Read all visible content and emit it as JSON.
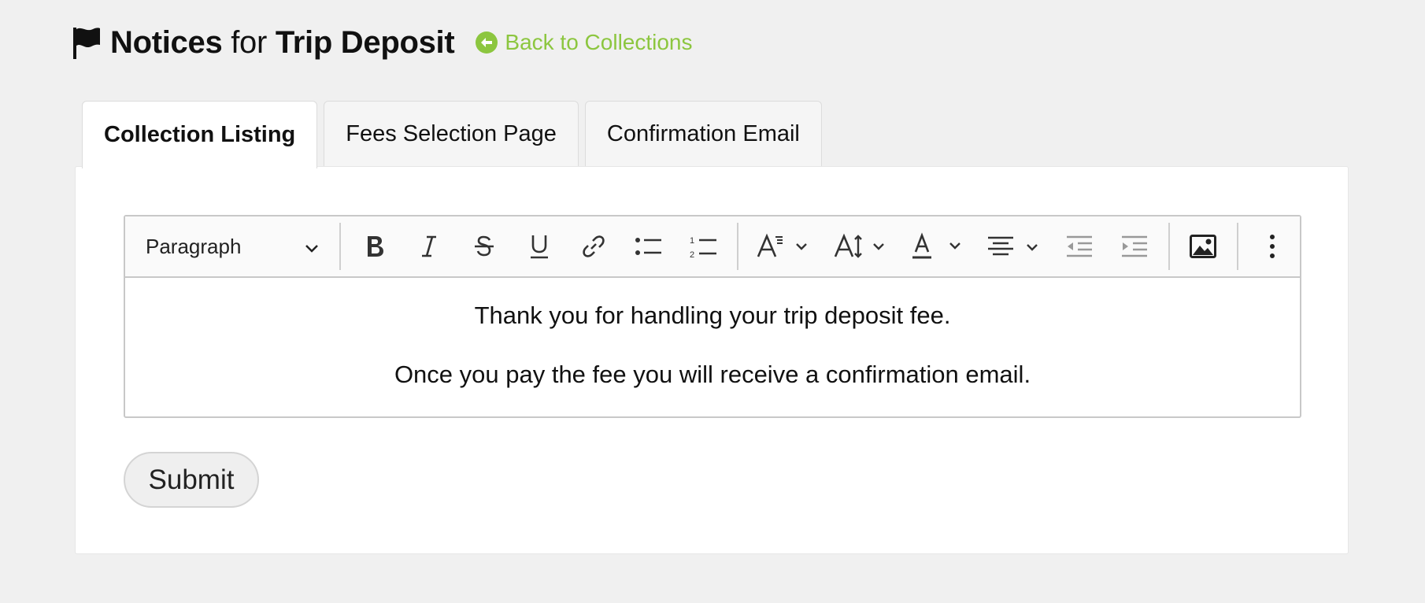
{
  "header": {
    "title_prefix": "Notices",
    "title_connector": "for",
    "title_name": "Trip Deposit",
    "back_link_label": "Back to Collections",
    "flag_icon": "flag-icon",
    "back_icon": "arrow-circle-left-icon"
  },
  "tabs": [
    {
      "label": "Collection Listing",
      "active": true
    },
    {
      "label": "Fees Selection Page",
      "active": false
    },
    {
      "label": "Confirmation Email",
      "active": false
    }
  ],
  "editor": {
    "block_format": "Paragraph",
    "toolbar_icons": [
      "bold-icon",
      "italic-icon",
      "strikethrough-icon",
      "underline-icon",
      "link-icon",
      "bulleted-list-icon",
      "numbered-list-icon",
      "font-family-icon",
      "font-size-icon",
      "font-color-icon",
      "align-center-icon",
      "outdent-icon",
      "indent-icon",
      "image-icon",
      "more-options-icon"
    ],
    "paragraphs": [
      "Thank you for handling your trip deposit fee.",
      "Once you pay the fee you will receive a confirmation email."
    ]
  },
  "form": {
    "submit_label": "Submit"
  },
  "colors": {
    "accent": "#8cc63f",
    "background": "#f0f0f0"
  }
}
